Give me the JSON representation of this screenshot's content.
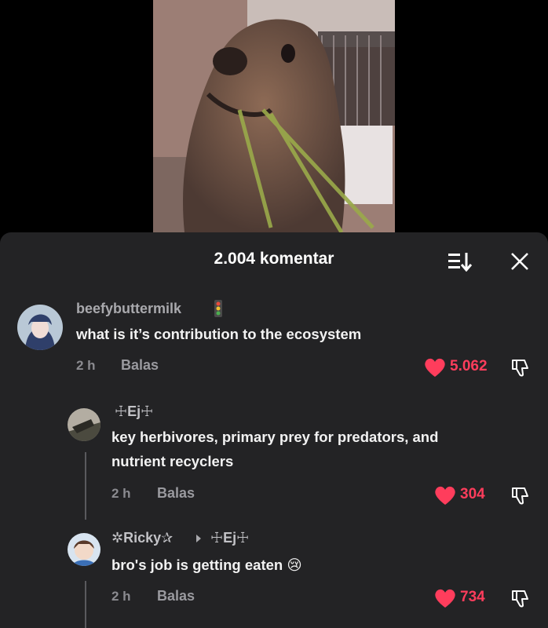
{
  "video": {
    "description_icon": "animal-photo"
  },
  "sheet": {
    "title": "2.004 komentar",
    "sort_icon": "sort-icon",
    "close_icon": "close-icon"
  },
  "colors": {
    "sheet_bg": "#232325",
    "like_red": "#ff3d5c",
    "muted_text": "#8b8b90"
  },
  "comments": [
    {
      "username": "beefybuttermilk",
      "badge_icon": "traffic-light-icon",
      "text": "what is it’s contribution to the ecosystem",
      "time": "2 h",
      "reply_label": "Balas",
      "likes": "5.062",
      "liked": true
    },
    {
      "username": "☩Ej☩",
      "text_line1": "key herbivores, primary prey for predators, and",
      "text_line2": "nutrient recyclers",
      "time": "2 h",
      "reply_label": "Balas",
      "likes": "304",
      "liked": true
    },
    {
      "username": "✲Ricky✰",
      "reply_to": "☩Ej☩",
      "text": "bro's job is getting eaten",
      "emoji": "😢",
      "time": "2 h",
      "reply_label": "Balas",
      "likes": "734",
      "liked": true
    }
  ]
}
